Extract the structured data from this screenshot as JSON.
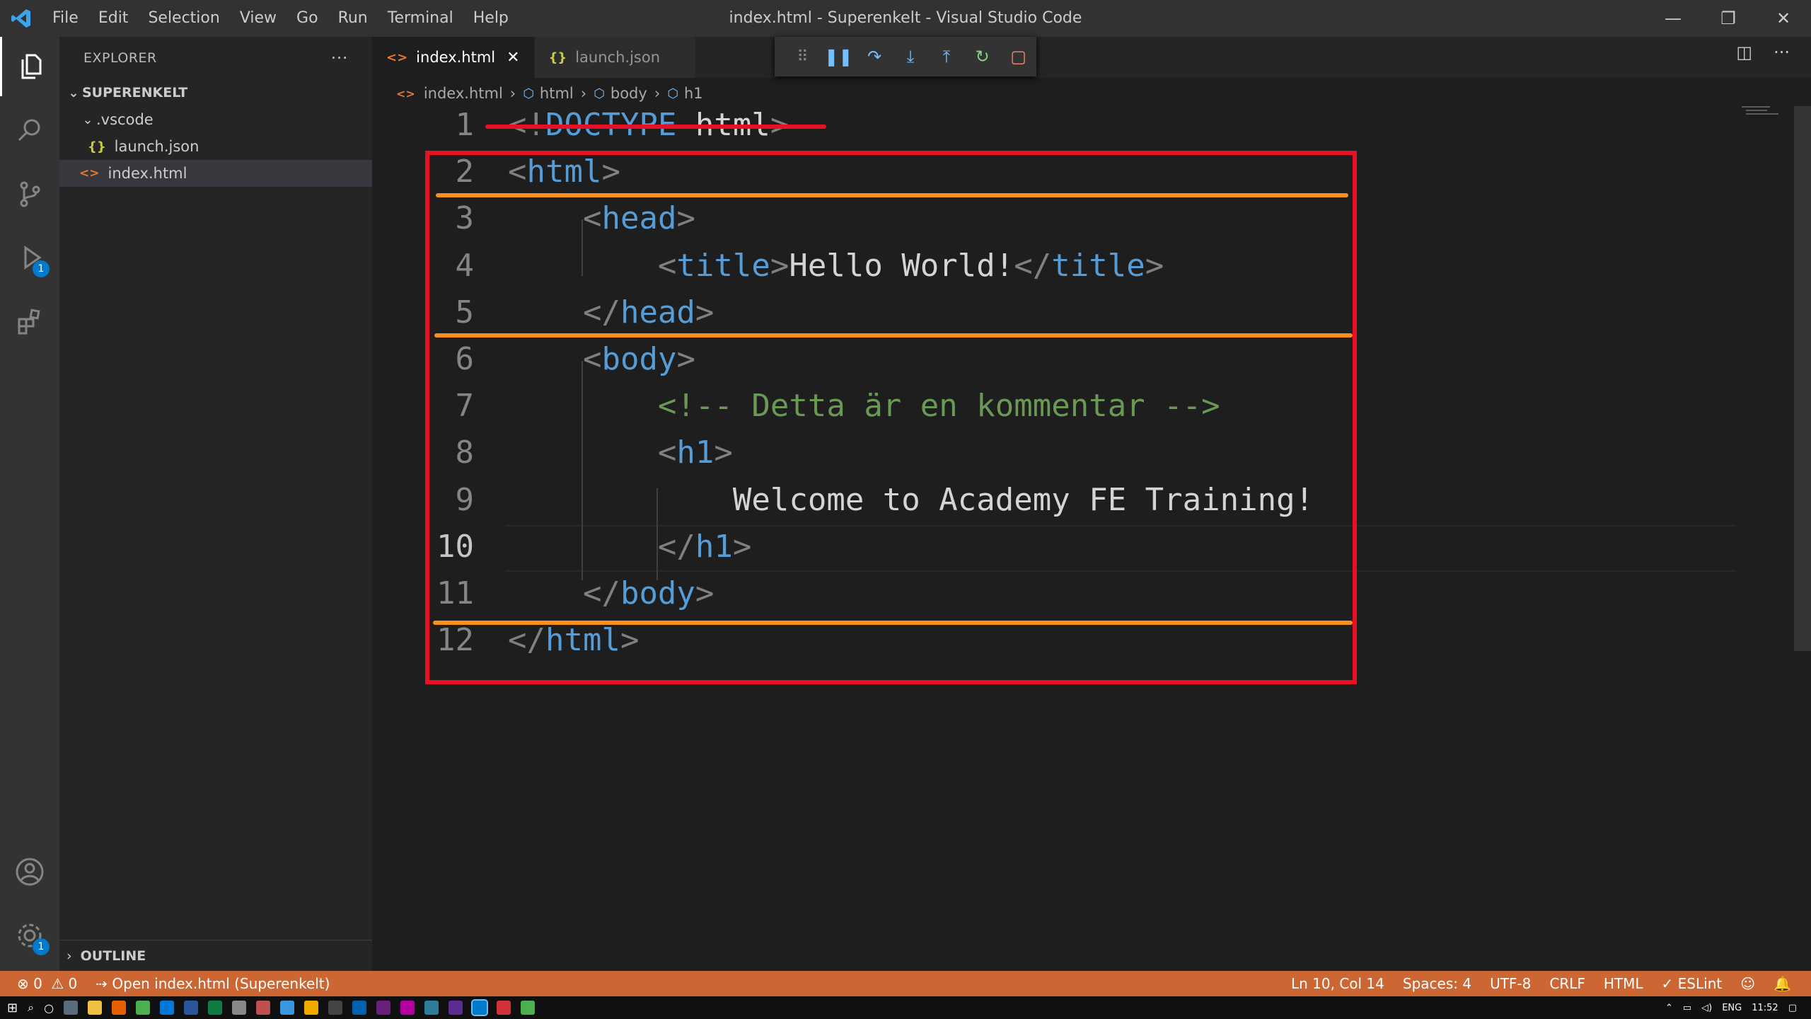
{
  "window": {
    "title": "index.html - Superenkelt - Visual Studio Code",
    "menu": [
      "File",
      "Edit",
      "Selection",
      "View",
      "Go",
      "Run",
      "Terminal",
      "Help"
    ]
  },
  "activity_bar": {
    "debug_badge": "1",
    "settings_badge": "1"
  },
  "sidebar": {
    "title": "EXPLORER",
    "more": "···",
    "folder": "SUPERENKELT",
    "items": [
      {
        "label": ".vscode",
        "type": "folder"
      },
      {
        "label": "launch.json",
        "type": "json"
      },
      {
        "label": "index.html",
        "type": "html"
      }
    ],
    "outline": "OUTLINE"
  },
  "tabs": [
    {
      "label": "index.html",
      "icon": "<>",
      "active": true
    },
    {
      "label": "launch.json",
      "icon": "{}",
      "active": false
    }
  ],
  "breadcrumb": [
    "index.html",
    "html",
    "body",
    "h1"
  ],
  "code_lines": [
    {
      "n": "1",
      "parts": [
        [
          "br",
          "<!"
        ],
        [
          "tag",
          "DOCTYPE"
        ],
        [
          "pl",
          " html"
        ],
        [
          "br",
          ">"
        ]
      ]
    },
    {
      "n": "2",
      "parts": [
        [
          "br",
          "<"
        ],
        [
          "tag",
          "html"
        ],
        [
          "br",
          ">"
        ]
      ]
    },
    {
      "n": "3",
      "parts": [
        [
          "pl",
          "    "
        ],
        [
          "br",
          "<"
        ],
        [
          "tag",
          "head"
        ],
        [
          "br",
          ">"
        ]
      ]
    },
    {
      "n": "4",
      "parts": [
        [
          "pl",
          "        "
        ],
        [
          "br",
          "<"
        ],
        [
          "tag",
          "title"
        ],
        [
          "br",
          ">"
        ],
        [
          "pl",
          "Hello World!"
        ],
        [
          "br",
          "</"
        ],
        [
          "tag",
          "title"
        ],
        [
          "br",
          ">"
        ]
      ]
    },
    {
      "n": "5",
      "parts": [
        [
          "pl",
          "    "
        ],
        [
          "br",
          "</"
        ],
        [
          "tag",
          "head"
        ],
        [
          "br",
          ">"
        ]
      ]
    },
    {
      "n": "6",
      "parts": [
        [
          "pl",
          "    "
        ],
        [
          "br",
          "<"
        ],
        [
          "tag",
          "body"
        ],
        [
          "br",
          ">"
        ]
      ]
    },
    {
      "n": "7",
      "parts": [
        [
          "pl",
          "        "
        ],
        [
          "cm",
          "<!-- Detta är en kommentar -->"
        ]
      ]
    },
    {
      "n": "8",
      "parts": [
        [
          "pl",
          "        "
        ],
        [
          "br",
          "<"
        ],
        [
          "tag",
          "h1"
        ],
        [
          "br",
          ">"
        ]
      ]
    },
    {
      "n": "9",
      "parts": [
        [
          "pl",
          "            Welcome to Academy FE Training!"
        ]
      ]
    },
    {
      "n": "10",
      "parts": [
        [
          "pl",
          "        "
        ],
        [
          "br",
          "</"
        ],
        [
          "tag",
          "h1"
        ],
        [
          "br",
          ">"
        ]
      ]
    },
    {
      "n": "11",
      "parts": [
        [
          "pl",
          "    "
        ],
        [
          "br",
          "</"
        ],
        [
          "tag",
          "body"
        ],
        [
          "br",
          ">"
        ]
      ]
    },
    {
      "n": "12",
      "parts": [
        [
          "br",
          "</"
        ],
        [
          "tag",
          "html"
        ],
        [
          "br",
          ">"
        ]
      ]
    }
  ],
  "current_line": "10",
  "status": {
    "errors": "0",
    "warnings": "0",
    "open_message": "Open index.html (Superenkelt)",
    "position": "Ln 10, Col 14",
    "spaces": "Spaces: 4",
    "encoding": "UTF-8",
    "eol": "CRLF",
    "language": "HTML",
    "eslint": "ESLint"
  },
  "taskbar": {
    "lang": "ENG",
    "time": "11:52"
  },
  "colors": {
    "annotation_box": "#e81123",
    "annotation_lines": "#f7901e",
    "statusbar": "#cc6633",
    "tag": "#569cd6",
    "comment": "#6a9955"
  }
}
